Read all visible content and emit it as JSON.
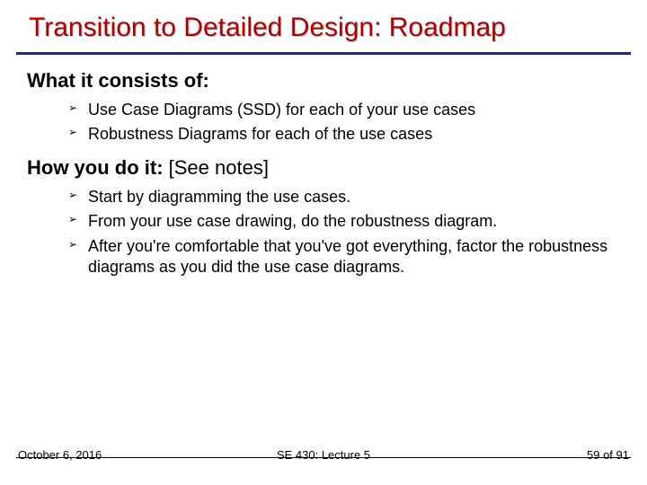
{
  "title": "Transition to Detailed Design: Roadmap",
  "section1": {
    "heading": "What it consists of:",
    "items": [
      "Use Case Diagrams (SSD) for each of your use cases",
      "Robustness Diagrams for each of the use cases"
    ]
  },
  "section2": {
    "heading_bold": "How you do it:",
    "heading_rest": " [See notes]",
    "items": [
      "Start by diagramming the use cases.",
      "From your use case drawing, do the robustness diagram.",
      "After you're comfortable that you've got everything, factor the robustness diagrams as you did the use case diagrams."
    ]
  },
  "footer": {
    "left": "October 6, 2016",
    "center": "SE 430: Lecture 5",
    "right": "59 of 91"
  }
}
